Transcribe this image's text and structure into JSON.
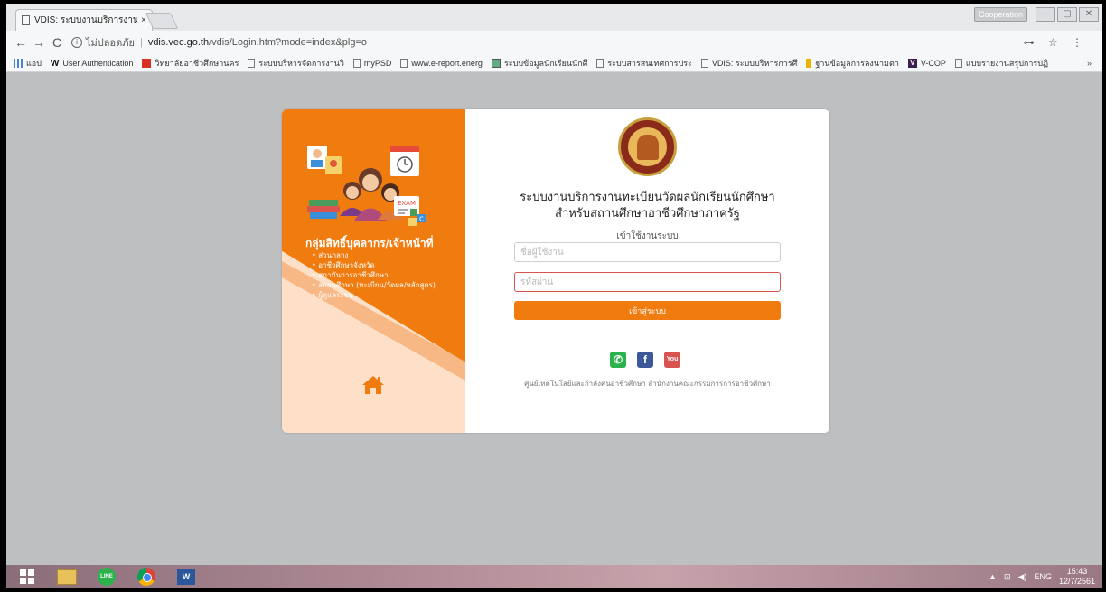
{
  "browser": {
    "tab_title": "VDIS: ระบบงานบริการงานทะ",
    "tab_close": "×",
    "profile_label": "Cooperation",
    "window_controls": [
      "—",
      "▢",
      "✕"
    ],
    "nav": {
      "back": "←",
      "forward": "→",
      "reload": "C"
    },
    "address": {
      "security_label": "ไม่ปลอดภัย",
      "url_host": "vdis.vec.go.th",
      "url_path": "/vdis/Login.htm?mode=index&plg=o",
      "icons": "⊶ ☆ ⋮"
    },
    "bookmarks": [
      {
        "label": "แอป",
        "icon": "apps-icon"
      },
      {
        "label": "User Authentication",
        "icon": "w-icon"
      },
      {
        "label": "วิทยาลัยอาชีวศึกษานคร",
        "icon": "g-icon"
      },
      {
        "label": "ระบบบริหารจัดการงานวิ",
        "icon": "page-icon"
      },
      {
        "label": "myPSD",
        "icon": "page-icon"
      },
      {
        "label": "www.e-report.energ",
        "icon": "page-icon"
      },
      {
        "label": "ระบบข้อมูลนักเรียนนักศึ",
        "icon": "image-icon"
      },
      {
        "label": "ระบบสารสนเทศการประ",
        "icon": "page-icon"
      },
      {
        "label": "VDIS: ระบบบริหารการศึ",
        "icon": "page-icon"
      },
      {
        "label": "ฐานข้อมูลการลงนามตา",
        "icon": "medal-icon"
      },
      {
        "label": "V-COP",
        "icon": "v-icon"
      },
      {
        "label": "แบบรายงานสรุปการปฏิ",
        "icon": "page-icon"
      }
    ],
    "bookmarks_more": "»"
  },
  "login_card": {
    "left": {
      "role_title": "กลุ่มสิทธิ์บุคลากร/เจ้าหน้าที่",
      "roles": [
        "ส่วนกลาง",
        "อาชีวศึกษาจังหวัด",
        "สถาบันการอาชีวศึกษา",
        "สถานศึกษา (ทะเบียน/วัดผล/หลักสูตร)",
        "ผู้ดูแลระบบ"
      ],
      "illustration_label": "EXAM"
    },
    "right": {
      "title_line1": "ระบบงานบริการงานทะเบียนวัดผลนักเรียนนักศึกษา",
      "title_line2": "สำหรับสถานศึกษาอาชีวศึกษาภาครัฐ",
      "login_heading": "เข้าใช้งานระบบ",
      "username_placeholder": "ชื่อผู้ใช้งาน",
      "password_placeholder": "รหัสผ่าน",
      "login_button": "เข้าสู่ระบบ",
      "social": {
        "line": "✆",
        "facebook": "f",
        "youtube": "You Tube"
      },
      "footer": "ศูนย์เทคโนโลยีและกำลังคนอาชีวศึกษา สำนักงานคณะกรรมการการอาชีวศึกษา"
    }
  },
  "taskbar": {
    "line_label": "LINE",
    "word_label": "W",
    "tray": {
      "arrow": "▲",
      "network": "⊡",
      "volume": "◀)",
      "lang": "ENG"
    },
    "clock_time": "15:43",
    "clock_date": "12/7/2561"
  }
}
